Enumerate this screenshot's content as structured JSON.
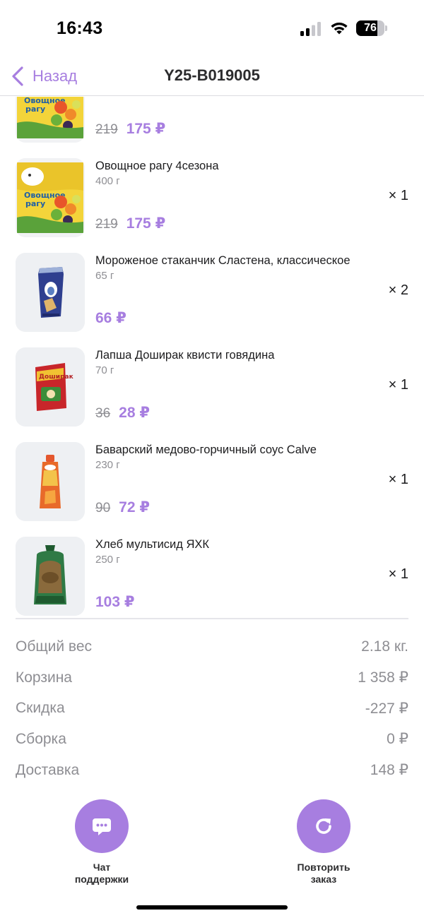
{
  "status_bar": {
    "time": "16:43",
    "battery": "76",
    "battery_level": 0.76
  },
  "nav": {
    "back_label": "Назад",
    "title": "Y25-B019005"
  },
  "items": [
    {
      "name": "",
      "weight": "",
      "price_old": "219",
      "price_new": "175 ₽",
      "qty": "",
      "image": "frozen-vegetables-bag"
    },
    {
      "name": "Овощное рагу 4сезона",
      "weight": "400 г",
      "price_old": "219",
      "price_new": "175 ₽",
      "qty": "× 1",
      "image": "frozen-vegetables-bag"
    },
    {
      "name": "Мороженое стаканчик Сластена, классическое",
      "weight": "65 г",
      "price_old": "",
      "price_new": "66 ₽",
      "qty": "× 2",
      "image": "ice-cream-cup"
    },
    {
      "name": "Лапша Доширак квисти говядина",
      "weight": "70 г",
      "price_old": "36",
      "price_new": "28 ₽",
      "qty": "× 1",
      "image": "noodle-pack"
    },
    {
      "name": "Баварский медово-горчичный соус Calve",
      "weight": "230 г",
      "price_old": "90",
      "price_new": "72 ₽",
      "qty": "× 1",
      "image": "sauce-pouch"
    },
    {
      "name": "Хлеб мультисид ЯХК",
      "weight": "250 г",
      "price_old": "",
      "price_new": "103 ₽",
      "qty": "× 1",
      "image": "bread-bag"
    }
  ],
  "summary": [
    {
      "label": "Общий вес",
      "value": "2.18 кг."
    },
    {
      "label": "Корзина",
      "value": "1 358 ₽"
    },
    {
      "label": "Скидка",
      "value": "-227 ₽"
    },
    {
      "label": "Сборка",
      "value": "0 ₽"
    },
    {
      "label": "Доставка",
      "value": "148 ₽"
    }
  ],
  "actions": {
    "chat": {
      "label_line1": "Чат",
      "label_line2": "поддержки",
      "icon": "chat-bubble-icon"
    },
    "repeat": {
      "label_line1": "Повторить",
      "label_line2": "заказ",
      "icon": "refresh-icon"
    }
  },
  "colors": {
    "accent": "#a77ee0",
    "muted": "#8e8e93",
    "text": "#1c1c1e"
  }
}
